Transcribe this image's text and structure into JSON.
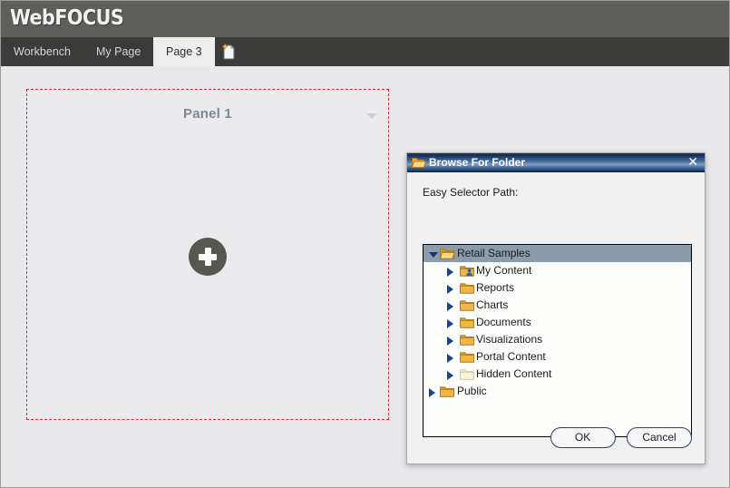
{
  "header": {
    "logo_text": "WebFOCUS",
    "background_color": "#5e5e5b"
  },
  "tabs": {
    "items": [
      {
        "label": "Workbench",
        "active": false
      },
      {
        "label": "My Page",
        "active": false
      },
      {
        "label": "Page 3",
        "active": true
      }
    ],
    "new_page_icon": "new-page-icon"
  },
  "canvas": {
    "panel": {
      "title": "Panel 1",
      "border_color": "#d32f2f",
      "background_color": "#ebebee",
      "title_color": "#7b8a99",
      "add_button_icon": "plus-icon",
      "menu_icon": "chevron-down-icon"
    }
  },
  "dialog": {
    "title": "Browse For Folder",
    "title_icon": "folder-open-icon",
    "close_label": "✕",
    "path_label": "Easy Selector Path:",
    "titlebar_color": "#16335e",
    "selection_color": "#8b9cac",
    "tree": [
      {
        "label": "Retail Samples",
        "level": 0,
        "state": "expanded",
        "selected": true,
        "icon": "folder-open-icon"
      },
      {
        "label": "My Content",
        "level": 1,
        "state": "collapsed",
        "selected": false,
        "icon": "folder-user-icon"
      },
      {
        "label": "Reports",
        "level": 1,
        "state": "collapsed",
        "selected": false,
        "icon": "folder-icon"
      },
      {
        "label": "Charts",
        "level": 1,
        "state": "collapsed",
        "selected": false,
        "icon": "folder-icon"
      },
      {
        "label": "Documents",
        "level": 1,
        "state": "collapsed",
        "selected": false,
        "icon": "folder-icon"
      },
      {
        "label": "Visualizations",
        "level": 1,
        "state": "collapsed",
        "selected": false,
        "icon": "folder-icon"
      },
      {
        "label": "Portal Content",
        "level": 1,
        "state": "collapsed",
        "selected": false,
        "icon": "folder-icon"
      },
      {
        "label": "Hidden Content",
        "level": 1,
        "state": "collapsed",
        "selected": false,
        "icon": "folder-hidden-icon"
      },
      {
        "label": "Public",
        "level": 0,
        "state": "collapsed",
        "selected": false,
        "icon": "folder-icon"
      }
    ],
    "buttons": [
      {
        "label": "OK"
      },
      {
        "label": "Cancel"
      }
    ]
  }
}
